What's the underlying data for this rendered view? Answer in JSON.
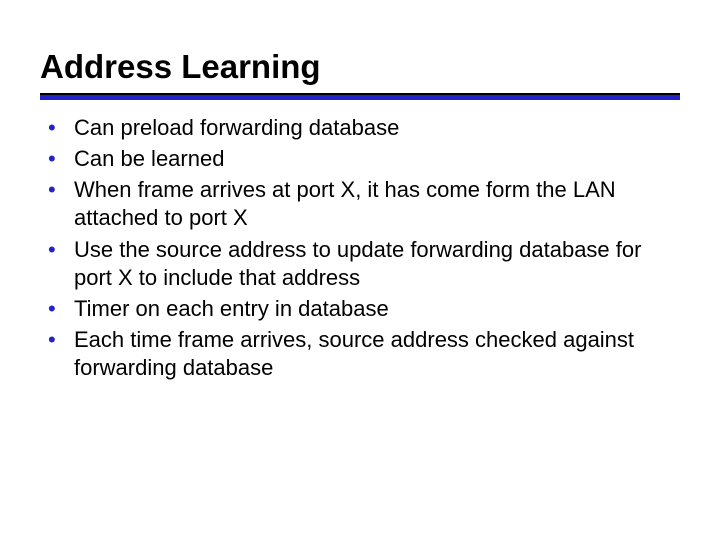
{
  "slide": {
    "title": "Address Learning",
    "bullets": [
      "Can preload forwarding database",
      "Can be learned",
      "When frame arrives at port X, it has come form the LAN attached to port X",
      "Use the source address to update forwarding database for port X to include that address",
      "Timer on each entry in database",
      "Each time frame arrives, source address checked against forwarding database"
    ]
  }
}
